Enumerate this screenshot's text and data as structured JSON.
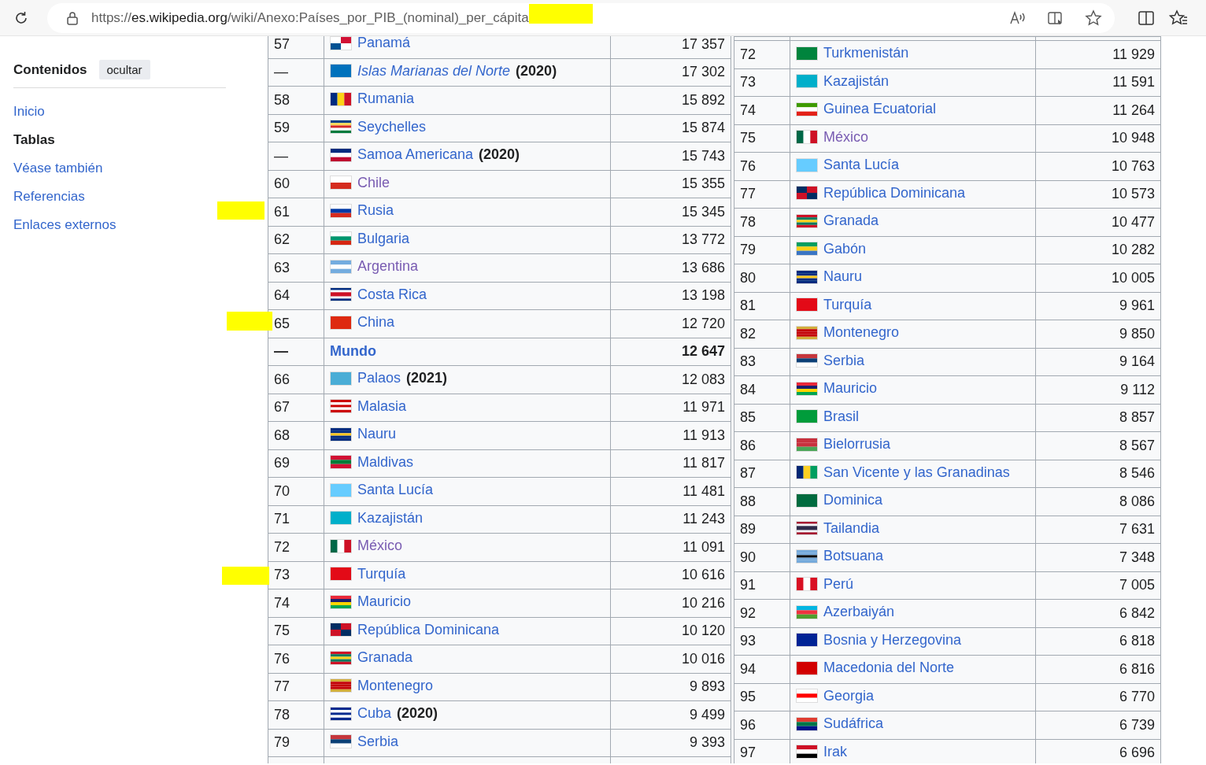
{
  "browser": {
    "url_scheme": "https://",
    "url_host": "es.wikipedia.org",
    "url_path": "/wiki/Anexo:Países_por_PIB_(nominal)_per_cápita"
  },
  "toc": {
    "title": "Contenidos",
    "hide_button": "ocultar",
    "items": [
      {
        "label": "Inicio",
        "selected": false
      },
      {
        "label": "Tablas",
        "selected": true
      },
      {
        "label": "Véase también",
        "selected": false
      },
      {
        "label": "Referencias",
        "selected": false
      },
      {
        "label": "Enlaces externos",
        "selected": false
      }
    ]
  },
  "left_table": {
    "rows": [
      {
        "kind": "country",
        "rank": "57",
        "name": "Panamá",
        "value": "17 357",
        "visited": false,
        "italic": false
      },
      {
        "kind": "country",
        "rank": "—",
        "name": "Islas Marianas del Norte",
        "note": "(2020)",
        "value": "17 302",
        "visited": false,
        "italic": true
      },
      {
        "kind": "country",
        "rank": "58",
        "name": "Rumania",
        "value": "15 892",
        "visited": false,
        "italic": false
      },
      {
        "kind": "country",
        "rank": "59",
        "name": "Seychelles",
        "value": "15 874",
        "visited": false,
        "italic": false
      },
      {
        "kind": "country",
        "rank": "—",
        "name": "Samoa Americana",
        "note": "(2020)",
        "value": "15 743",
        "visited": false,
        "italic": false
      },
      {
        "kind": "country",
        "rank": "60",
        "name": "Chile",
        "value": "15 355",
        "visited": true,
        "italic": false
      },
      {
        "kind": "country",
        "rank": "61",
        "name": "Rusia",
        "value": "15 345",
        "visited": false,
        "italic": false
      },
      {
        "kind": "country",
        "rank": "62",
        "name": "Bulgaria",
        "value": "13 772",
        "visited": false,
        "italic": false
      },
      {
        "kind": "country",
        "rank": "63",
        "name": "Argentina",
        "value": "13 686",
        "visited": true,
        "italic": false
      },
      {
        "kind": "country",
        "rank": "64",
        "name": "Costa Rica",
        "value": "13 198",
        "visited": false,
        "italic": false
      },
      {
        "kind": "country",
        "rank": "65",
        "name": "China",
        "value": "12 720",
        "visited": false,
        "italic": false
      },
      {
        "kind": "world",
        "rank": "—",
        "name": "Mundo",
        "value": "12 647",
        "visited": false,
        "italic": false
      },
      {
        "kind": "country",
        "rank": "66",
        "name": "Palaos",
        "note": "(2021)",
        "value": "12 083",
        "visited": false,
        "italic": false
      },
      {
        "kind": "country",
        "rank": "67",
        "name": "Malasia",
        "value": "11 971",
        "visited": false,
        "italic": false
      },
      {
        "kind": "country",
        "rank": "68",
        "name": "Nauru",
        "value": "11 913",
        "visited": false,
        "italic": false
      },
      {
        "kind": "country",
        "rank": "69",
        "name": "Maldivas",
        "value": "11 817",
        "visited": false,
        "italic": false
      },
      {
        "kind": "country",
        "rank": "70",
        "name": "Santa Lucía",
        "value": "11 481",
        "visited": false,
        "italic": false
      },
      {
        "kind": "country",
        "rank": "71",
        "name": "Kazajistán",
        "value": "11 243",
        "visited": false,
        "italic": false
      },
      {
        "kind": "country",
        "rank": "72",
        "name": "México",
        "value": "11 091",
        "visited": true,
        "italic": false
      },
      {
        "kind": "country",
        "rank": "73",
        "name": "Turquía",
        "value": "10 616",
        "visited": false,
        "italic": false
      },
      {
        "kind": "country",
        "rank": "74",
        "name": "Mauricio",
        "value": "10 216",
        "visited": false,
        "italic": false
      },
      {
        "kind": "country",
        "rank": "75",
        "name": "República Dominicana",
        "value": "10 120",
        "visited": false,
        "italic": false
      },
      {
        "kind": "country",
        "rank": "76",
        "name": "Granada",
        "value": "10 016",
        "visited": false,
        "italic": false
      },
      {
        "kind": "country",
        "rank": "77",
        "name": "Montenegro",
        "value": "9 893",
        "visited": false,
        "italic": false
      },
      {
        "kind": "country",
        "rank": "78",
        "name": "Cuba",
        "note": "(2020)",
        "value": "9 499",
        "visited": false,
        "italic": false
      },
      {
        "kind": "country",
        "rank": "79",
        "name": "Serbia",
        "value": "9 393",
        "visited": false,
        "italic": false
      }
    ]
  },
  "right_table": {
    "rows": [
      {
        "kind": "country",
        "rank": "72",
        "name": "Turkmenistán",
        "value": "11 929",
        "visited": false,
        "italic": false
      },
      {
        "kind": "country",
        "rank": "73",
        "name": "Kazajistán",
        "value": "11 591",
        "visited": false,
        "italic": false
      },
      {
        "kind": "country",
        "rank": "74",
        "name": "Guinea Ecuatorial",
        "value": "11 264",
        "visited": false,
        "italic": false
      },
      {
        "kind": "country",
        "rank": "75",
        "name": "México",
        "value": "10 948",
        "visited": true,
        "italic": false
      },
      {
        "kind": "country",
        "rank": "76",
        "name": "Santa Lucía",
        "value": "10 763",
        "visited": false,
        "italic": false
      },
      {
        "kind": "country",
        "rank": "77",
        "name": "República Dominicana",
        "value": "10 573",
        "visited": false,
        "italic": false
      },
      {
        "kind": "country",
        "rank": "78",
        "name": "Granada",
        "value": "10 477",
        "visited": false,
        "italic": false
      },
      {
        "kind": "country",
        "rank": "79",
        "name": "Gabón",
        "value": "10 282",
        "visited": false,
        "italic": false
      },
      {
        "kind": "country",
        "rank": "80",
        "name": "Nauru",
        "value": "10 005",
        "visited": false,
        "italic": false
      },
      {
        "kind": "country",
        "rank": "81",
        "name": "Turquía",
        "value": "9 961",
        "visited": false,
        "italic": false
      },
      {
        "kind": "country",
        "rank": "82",
        "name": "Montenegro",
        "value": "9 850",
        "visited": false,
        "italic": false
      },
      {
        "kind": "country",
        "rank": "83",
        "name": "Serbia",
        "value": "9 164",
        "visited": false,
        "italic": false
      },
      {
        "kind": "country",
        "rank": "84",
        "name": "Mauricio",
        "value": "9 112",
        "visited": false,
        "italic": false
      },
      {
        "kind": "country",
        "rank": "85",
        "name": "Brasil",
        "value": "8 857",
        "visited": false,
        "italic": false
      },
      {
        "kind": "country",
        "rank": "86",
        "name": "Bielorrusia",
        "value": "8 567",
        "visited": false,
        "italic": false
      },
      {
        "kind": "country",
        "rank": "87",
        "name": "San Vicente y las Granadinas",
        "value": "8 546",
        "visited": false,
        "italic": false
      },
      {
        "kind": "country",
        "rank": "88",
        "name": "Dominica",
        "value": "8 086",
        "visited": false,
        "italic": false
      },
      {
        "kind": "country",
        "rank": "89",
        "name": "Tailandia",
        "value": "7 631",
        "visited": false,
        "italic": false
      },
      {
        "kind": "country",
        "rank": "90",
        "name": "Botsuana",
        "value": "7 348",
        "visited": false,
        "italic": false
      },
      {
        "kind": "country",
        "rank": "91",
        "name": "Perú",
        "value": "7 005",
        "visited": false,
        "italic": false
      },
      {
        "kind": "country",
        "rank": "92",
        "name": "Azerbaiyán",
        "value": "6 842",
        "visited": false,
        "italic": false
      },
      {
        "kind": "country",
        "rank": "93",
        "name": "Bosnia y Herzegovina",
        "value": "6 818",
        "visited": false,
        "italic": false
      },
      {
        "kind": "country",
        "rank": "94",
        "name": "Macedonia del Norte",
        "value": "6 816",
        "visited": false,
        "italic": false
      },
      {
        "kind": "country",
        "rank": "95",
        "name": "Georgia",
        "value": "6 770",
        "visited": false,
        "italic": false
      },
      {
        "kind": "country",
        "rank": "96",
        "name": "Sudáfrica",
        "value": "6 739",
        "visited": false,
        "italic": false
      },
      {
        "kind": "country",
        "rank": "97",
        "name": "Irak",
        "value": "6 696",
        "visited": false,
        "italic": false
      }
    ]
  }
}
